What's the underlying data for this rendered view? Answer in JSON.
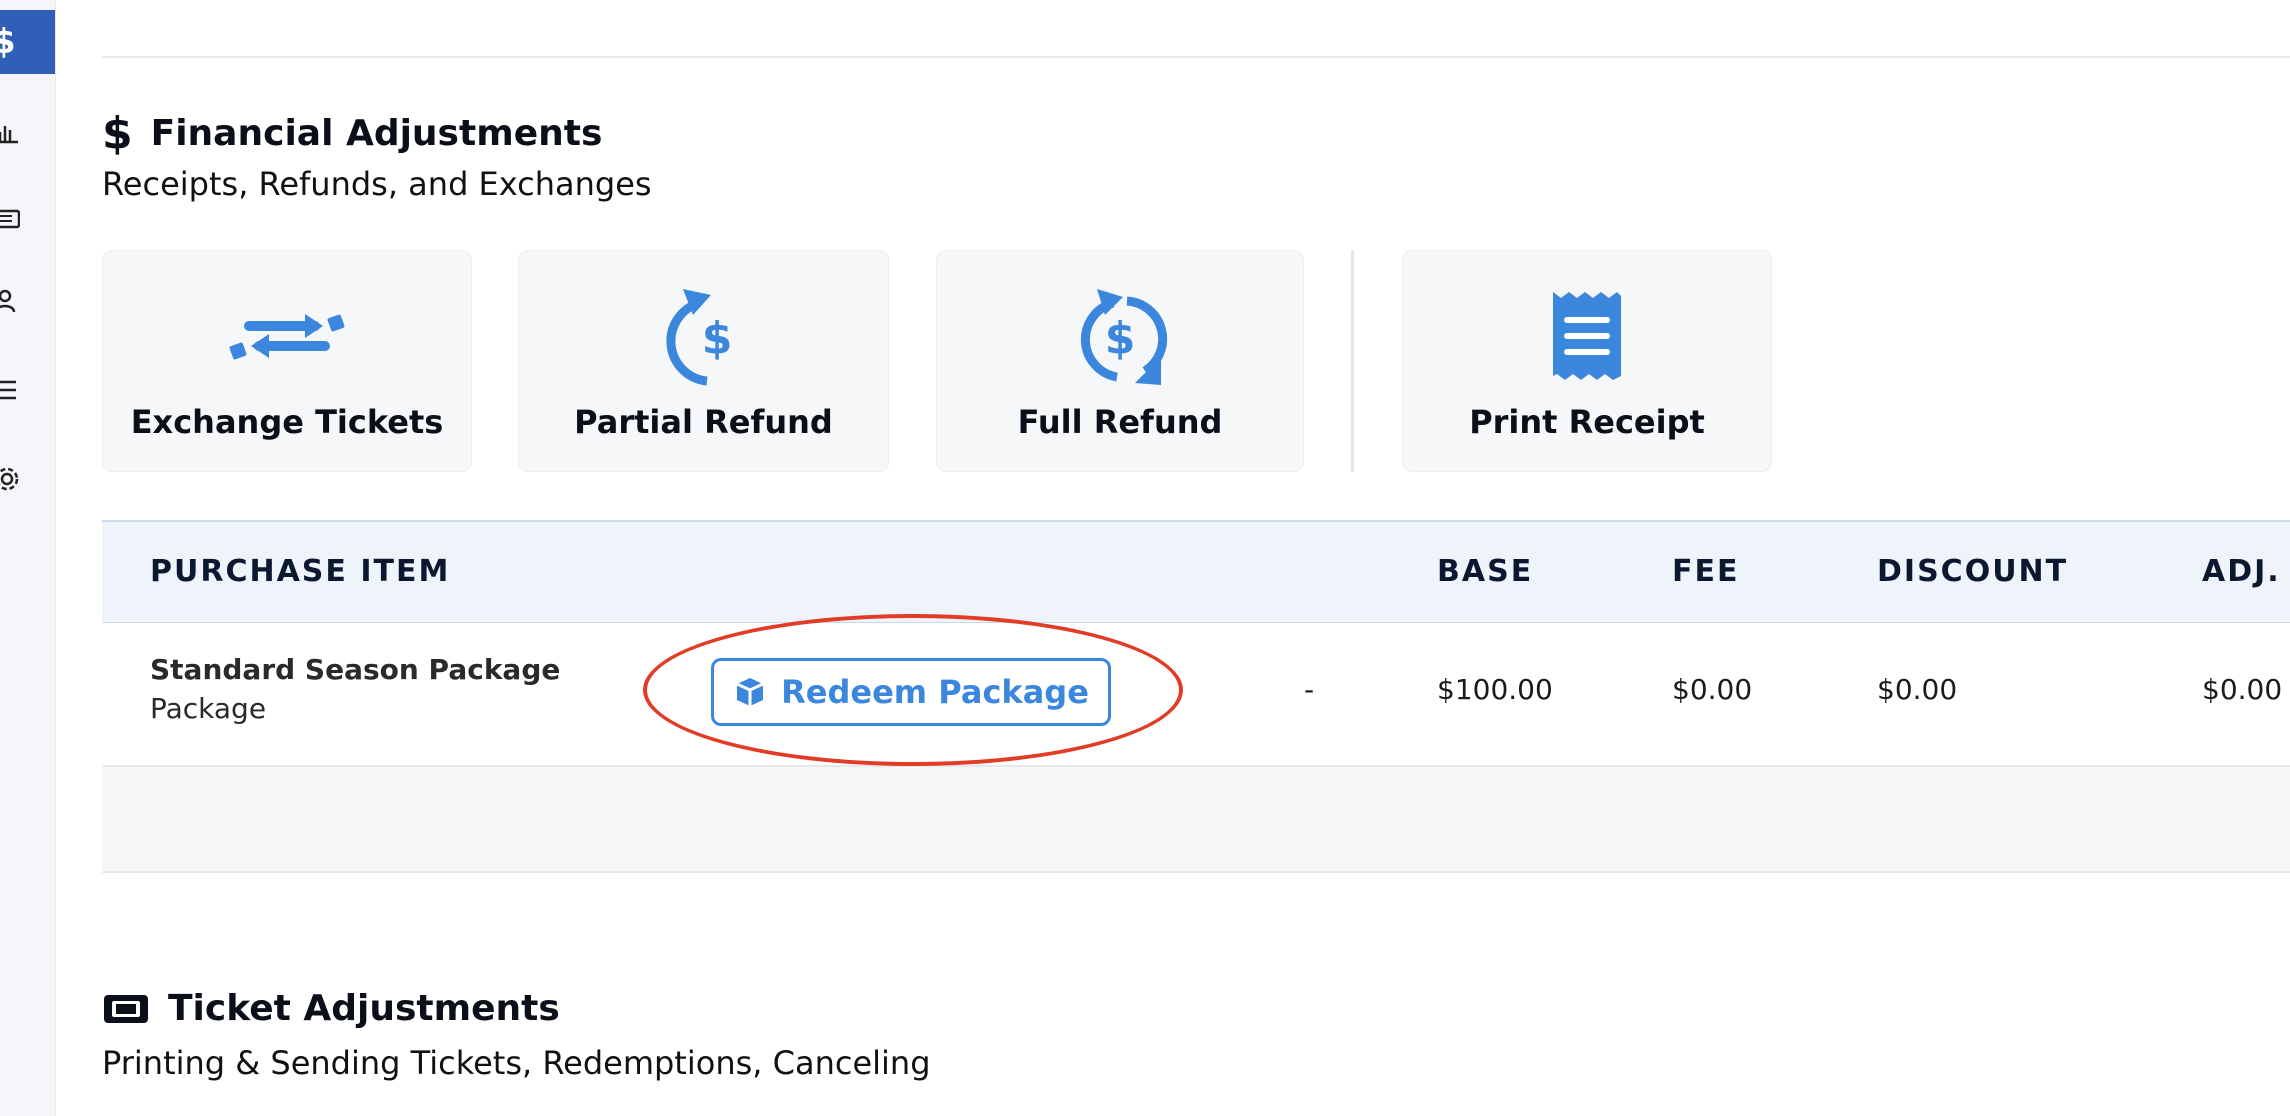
{
  "sidebar": {
    "active_icon": "dollar-icon",
    "active_glyph": "$",
    "icons": [
      "chart-icon",
      "ticket-icon",
      "users-icon",
      "list-icon",
      "gear-icon"
    ]
  },
  "financial": {
    "title": "Financial Adjustments",
    "subtitle": "Receipts, Refunds, and Exchanges",
    "icon": "dollar-icon",
    "tiles": [
      {
        "label": "Exchange Tickets",
        "icon": "exchange-icon"
      },
      {
        "label": "Partial Refund",
        "icon": "partial-refund-icon"
      },
      {
        "label": "Full Refund",
        "icon": "full-refund-icon"
      },
      {
        "label": "Print Receipt",
        "icon": "receipt-icon"
      }
    ]
  },
  "table": {
    "headers": {
      "item": "PURCHASE ITEM",
      "base": "BASE",
      "fee": "FEE",
      "discount": "DISCOUNT",
      "adj": "ADJ."
    },
    "rows": [
      {
        "name": "Standard Season Package",
        "type": "Package",
        "action": "Redeem Package",
        "dash": "-",
        "base": "$100.00",
        "fee": "$0.00",
        "discount": "$0.00",
        "adj": "$0.00"
      }
    ]
  },
  "ticket": {
    "title": "Ticket Adjustments",
    "subtitle": "Printing & Sending Tickets, Redemptions, Canceling",
    "icon": "ticket-icon"
  },
  "colors": {
    "accent": "#3b87dd",
    "sidebar_active": "#2f5fb6",
    "annotation": "#e23b26"
  }
}
